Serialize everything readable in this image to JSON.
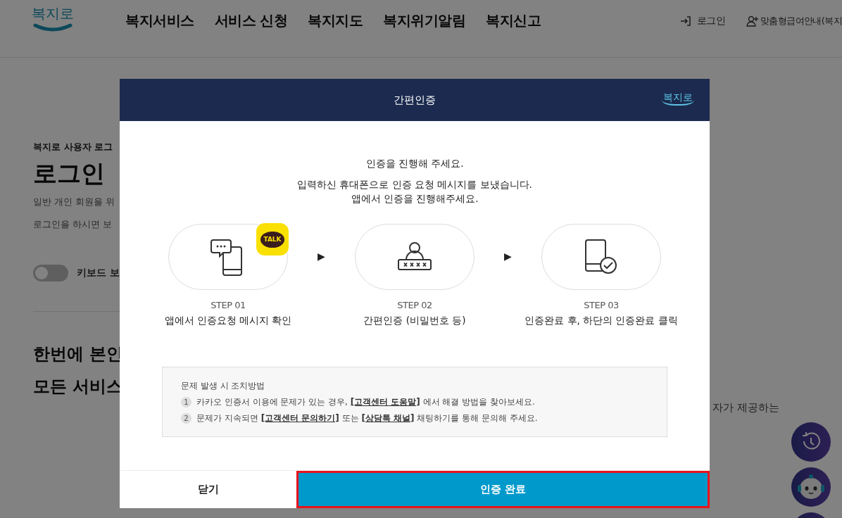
{
  "header": {
    "logo_text": "복지로",
    "nav": [
      "복지서비스",
      "서비스 신청",
      "복지지도",
      "복지위기알림",
      "복지신고"
    ],
    "login": "로그인",
    "guide": "맞춤형급여안내(복지"
  },
  "page": {
    "eyebrow": "복지로 사용자 로그",
    "title": "로그인",
    "lines": [
      "일반 개인 회원을 위",
      "로그인을 하시면 보"
    ],
    "keyboard_toggle": {
      "label": "키보드 보",
      "on": false
    },
    "headline": [
      "한번에 본인",
      "모든 서비스"
    ],
    "side_text": "자가 제공하는"
  },
  "modal": {
    "title": "간편인증",
    "logo_text": "복지로",
    "intro": "인증을 진행해 주세요.",
    "message": [
      "입력하신 휴대폰으로 인증 요청 메시지를 보냈습니다.",
      "앱에서 인증을 진행해주세요."
    ],
    "steps": [
      {
        "kind": "message",
        "badge": "TALK",
        "step": "STEP 01",
        "caption": "앱에서 인증요청 메시지 확인"
      },
      {
        "kind": "password",
        "step": "STEP 02",
        "caption": "간편인증 (비밀번호 등)"
      },
      {
        "kind": "check",
        "step": "STEP 03",
        "caption": "인증완료 후, 하단의 인증완료 클릭"
      }
    ],
    "arrows": [
      "▶",
      "▶"
    ],
    "help": {
      "title": "문제 발생 시 조치방법",
      "items": [
        {
          "number": "1",
          "parts": [
            {
              "text": "카카오 인증서 이용에 문제가 있는 경우, ",
              "link": false
            },
            {
              "text": "[고객센터 도움말]",
              "link": true
            },
            {
              "text": " 에서 해결 방법을 찾아보세요.",
              "link": false
            }
          ]
        },
        {
          "number": "2",
          "parts": [
            {
              "text": "문제가 지속되면 ",
              "link": false
            },
            {
              "text": "[고객센터 문의하기]",
              "link": true
            },
            {
              "text": " 또는 ",
              "link": false
            },
            {
              "text": "[상담톡 채널]",
              "link": true
            },
            {
              "text": " 채팅하기를 통해 문의해 주세요.",
              "link": false
            }
          ]
        }
      ]
    },
    "buttons": [
      {
        "label": "닫기",
        "kind": "close",
        "highlighted": false
      },
      {
        "label": "인증 완료",
        "kind": "primary",
        "highlighted": true
      }
    ]
  }
}
